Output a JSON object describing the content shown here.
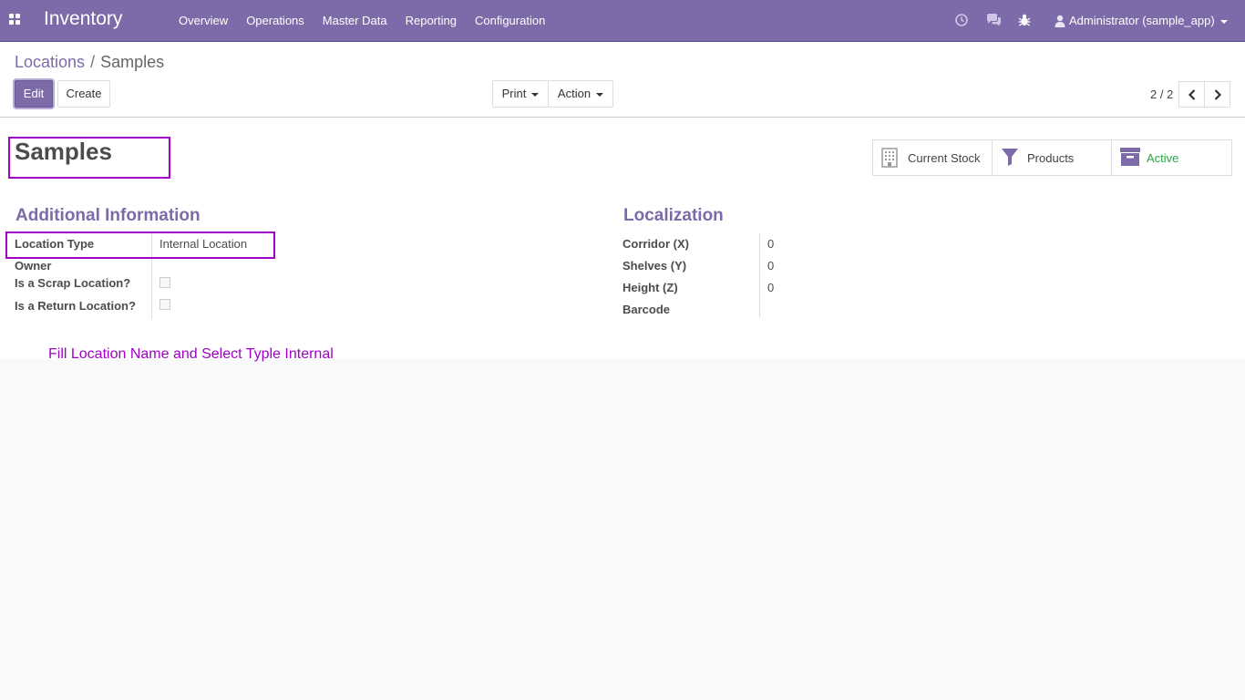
{
  "navbar": {
    "brand": "Inventory",
    "menu": [
      "Overview",
      "Operations",
      "Master Data",
      "Reporting",
      "Configuration"
    ],
    "user": "Administrator (sample_app)",
    "icons": [
      "clock-icon",
      "chat-icon",
      "bug-icon",
      "user-icon"
    ]
  },
  "breadcrumb": {
    "parent": "Locations",
    "separator": "/",
    "current": "Samples"
  },
  "toolbar": {
    "edit_label": "Edit",
    "create_label": "Create",
    "print_label": "Print",
    "action_label": "Action",
    "pager": "2 / 2"
  },
  "form": {
    "name": "Samples",
    "smart_buttons": {
      "current_stock": "Current Stock",
      "products": "Products",
      "active": "Active"
    },
    "additional_information": {
      "title": "Additional Information",
      "location_type_label": "Location Type",
      "location_type_value": "Internal Location",
      "owner_label": "Owner",
      "owner_value": "",
      "scrap_label": "Is a Scrap Location?",
      "scrap_checked": false,
      "return_label": "Is a Return Location?",
      "return_checked": false
    },
    "localization": {
      "title": "Localization",
      "corridor_label": "Corridor (X)",
      "corridor_value": "0",
      "shelves_label": "Shelves (Y)",
      "shelves_value": "0",
      "height_label": "Height (Z)",
      "height_value": "0",
      "barcode_label": "Barcode",
      "barcode_value": ""
    }
  },
  "annotation": "Fill Location Name and Select Typle Internal",
  "colors": {
    "brand": "#7c6ba8",
    "highlight": "#a000c8",
    "active": "#28a745"
  }
}
